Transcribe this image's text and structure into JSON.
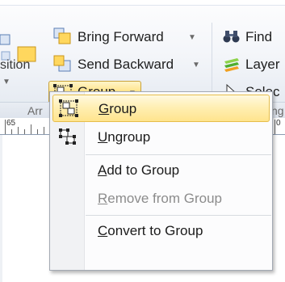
{
  "ribbon": {
    "bring_forward": "Bring Forward",
    "send_backward": "Send Backward",
    "group_button": "Group",
    "position_partial": "sition",
    "find_partial": "Find",
    "layer_partial": "Layer",
    "select_partial": "Selec",
    "arrange_label_partial": "Arr",
    "ng_partial": "ng",
    "dropdown_glyph": "▼"
  },
  "ruler": {
    "mark_1": "65",
    "mark_2": "0"
  },
  "menu": {
    "items": [
      {
        "pre": "",
        "u": "G",
        "post": "roup",
        "icon": "group-icon",
        "disabled": false,
        "highlighted": true
      },
      {
        "pre": "",
        "u": "U",
        "post": "ngroup",
        "icon": "ungroup-icon",
        "disabled": false,
        "highlighted": false
      },
      {
        "pre": "",
        "u": "A",
        "post": "dd to Group",
        "icon": "",
        "disabled": false,
        "highlighted": false
      },
      {
        "pre": "",
        "u": "R",
        "post": "emove from Group",
        "icon": "",
        "disabled": true,
        "highlighted": false
      },
      {
        "pre": "",
        "u": "C",
        "post": "onvert to Group",
        "icon": "",
        "disabled": false,
        "highlighted": false
      }
    ]
  },
  "colors": {
    "highlight": "#ffe48d",
    "highlight_border": "#e6be4c",
    "disabled_text": "#8c8c8c"
  }
}
